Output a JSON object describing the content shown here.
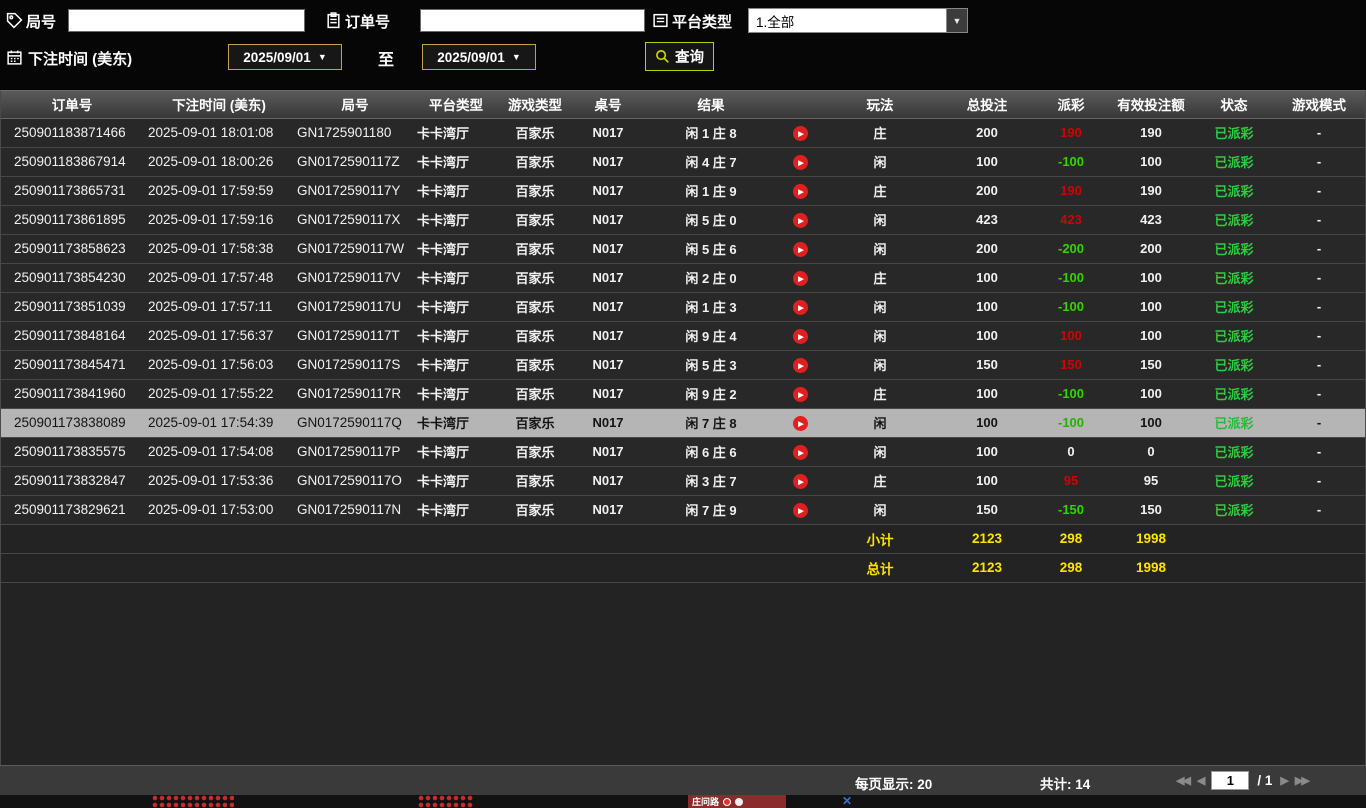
{
  "filters": {
    "round_label": "局号",
    "round_value": "",
    "order_label": "订单号",
    "order_value": "",
    "platform_label": "平台类型",
    "platform_value": "1.全部",
    "bet_time_label": "下注时间 (美东)",
    "date_from": "2025/09/01",
    "to_label": "至",
    "date_to": "2025/09/01",
    "search_label": "查询"
  },
  "table": {
    "headers": [
      "订单号",
      "下注时间 (美东)",
      "局号",
      "平台类型",
      "游戏类型",
      "桌号",
      "结果",
      "",
      "玩法",
      "总投注",
      "派彩",
      "有效投注额",
      "状态",
      "游戏模式"
    ],
    "rows": [
      {
        "order_no": "250901183871466",
        "time": "2025-09-01 18:01:08",
        "round": "GN1725901180",
        "platform": "卡卡湾厅",
        "game": "百家乐",
        "table_no": "N017",
        "result": "闲 1 庄 8",
        "play": "庄",
        "total_bet": "200",
        "payout": "190",
        "payout_class": "pos",
        "valid_bet": "190",
        "status": "已派彩",
        "mode": "-",
        "highlighted": false
      },
      {
        "order_no": "250901183867914",
        "time": "2025-09-01 18:00:26",
        "round": "GN0172590117Z",
        "platform": "卡卡湾厅",
        "game": "百家乐",
        "table_no": "N017",
        "result": "闲 4 庄 7",
        "play": "闲",
        "total_bet": "100",
        "payout": "-100",
        "payout_class": "neg",
        "valid_bet": "100",
        "status": "已派彩",
        "mode": "-",
        "highlighted": false
      },
      {
        "order_no": "250901173865731",
        "time": "2025-09-01 17:59:59",
        "round": "GN0172590117Y",
        "platform": "卡卡湾厅",
        "game": "百家乐",
        "table_no": "N017",
        "result": "闲 1 庄 9",
        "play": "庄",
        "total_bet": "200",
        "payout": "190",
        "payout_class": "pos",
        "valid_bet": "190",
        "status": "已派彩",
        "mode": "-",
        "highlighted": false
      },
      {
        "order_no": "250901173861895",
        "time": "2025-09-01 17:59:16",
        "round": "GN0172590117X",
        "platform": "卡卡湾厅",
        "game": "百家乐",
        "table_no": "N017",
        "result": "闲 5 庄 0",
        "play": "闲",
        "total_bet": "423",
        "payout": "423",
        "payout_class": "pos",
        "valid_bet": "423",
        "status": "已派彩",
        "mode": "-",
        "highlighted": false
      },
      {
        "order_no": "250901173858623",
        "time": "2025-09-01 17:58:38",
        "round": "GN0172590117W",
        "platform": "卡卡湾厅",
        "game": "百家乐",
        "table_no": "N017",
        "result": "闲 5 庄 6",
        "play": "闲",
        "total_bet": "200",
        "payout": "-200",
        "payout_class": "neg",
        "valid_bet": "200",
        "status": "已派彩",
        "mode": "-",
        "highlighted": false
      },
      {
        "order_no": "250901173854230",
        "time": "2025-09-01 17:57:48",
        "round": "GN0172590117V",
        "platform": "卡卡湾厅",
        "game": "百家乐",
        "table_no": "N017",
        "result": "闲 2 庄 0",
        "play": "庄",
        "total_bet": "100",
        "payout": "-100",
        "payout_class": "neg",
        "valid_bet": "100",
        "status": "已派彩",
        "mode": "-",
        "highlighted": false
      },
      {
        "order_no": "250901173851039",
        "time": "2025-09-01 17:57:11",
        "round": "GN0172590117U",
        "platform": "卡卡湾厅",
        "game": "百家乐",
        "table_no": "N017",
        "result": "闲 1 庄 3",
        "play": "闲",
        "total_bet": "100",
        "payout": "-100",
        "payout_class": "neg",
        "valid_bet": "100",
        "status": "已派彩",
        "mode": "-",
        "highlighted": false
      },
      {
        "order_no": "250901173848164",
        "time": "2025-09-01 17:56:37",
        "round": "GN0172590117T",
        "platform": "卡卡湾厅",
        "game": "百家乐",
        "table_no": "N017",
        "result": "闲 9 庄 4",
        "play": "闲",
        "total_bet": "100",
        "payout": "100",
        "payout_class": "pos",
        "valid_bet": "100",
        "status": "已派彩",
        "mode": "-",
        "highlighted": false
      },
      {
        "order_no": "250901173845471",
        "time": "2025-09-01 17:56:03",
        "round": "GN0172590117S",
        "platform": "卡卡湾厅",
        "game": "百家乐",
        "table_no": "N017",
        "result": "闲 5 庄 3",
        "play": "闲",
        "total_bet": "150",
        "payout": "150",
        "payout_class": "pos",
        "valid_bet": "150",
        "status": "已派彩",
        "mode": "-",
        "highlighted": false
      },
      {
        "order_no": "250901173841960",
        "time": "2025-09-01 17:55:22",
        "round": "GN0172590117R",
        "platform": "卡卡湾厅",
        "game": "百家乐",
        "table_no": "N017",
        "result": "闲 9 庄 2",
        "play": "庄",
        "total_bet": "100",
        "payout": "-100",
        "payout_class": "neg",
        "valid_bet": "100",
        "status": "已派彩",
        "mode": "-",
        "highlighted": false
      },
      {
        "order_no": "250901173838089",
        "time": "2025-09-01 17:54:39",
        "round": "GN0172590117Q",
        "platform": "卡卡湾厅",
        "game": "百家乐",
        "table_no": "N017",
        "result": "闲 7 庄 8",
        "play": "闲",
        "total_bet": "100",
        "payout": "-100",
        "payout_class": "neg",
        "valid_bet": "100",
        "status": "已派彩",
        "mode": "-",
        "highlighted": true
      },
      {
        "order_no": "250901173835575",
        "time": "2025-09-01 17:54:08",
        "round": "GN0172590117P",
        "platform": "卡卡湾厅",
        "game": "百家乐",
        "table_no": "N017",
        "result": "闲 6 庄 6",
        "play": "闲",
        "total_bet": "100",
        "payout": "0",
        "payout_class": "zero",
        "valid_bet": "0",
        "status": "已派彩",
        "mode": "-",
        "highlighted": false
      },
      {
        "order_no": "250901173832847",
        "time": "2025-09-01 17:53:36",
        "round": "GN0172590117O",
        "platform": "卡卡湾厅",
        "game": "百家乐",
        "table_no": "N017",
        "result": "闲 3 庄 7",
        "play": "庄",
        "total_bet": "100",
        "payout": "95",
        "payout_class": "pos",
        "valid_bet": "95",
        "status": "已派彩",
        "mode": "-",
        "highlighted": false
      },
      {
        "order_no": "250901173829621",
        "time": "2025-09-01 17:53:00",
        "round": "GN0172590117N",
        "platform": "卡卡湾厅",
        "game": "百家乐",
        "table_no": "N017",
        "result": "闲 7 庄 9",
        "play": "闲",
        "total_bet": "150",
        "payout": "-150",
        "payout_class": "neg",
        "valid_bet": "150",
        "status": "已派彩",
        "mode": "-",
        "highlighted": false
      }
    ],
    "subtotal": {
      "label": "小计",
      "total_bet": "2123",
      "payout": "298",
      "valid_bet": "1998"
    },
    "total": {
      "label": "总计",
      "total_bet": "2123",
      "payout": "298",
      "valid_bet": "1998"
    }
  },
  "footer": {
    "per_page": "每页显示: 20",
    "total_count": "共计: 14",
    "page": "1",
    "page_total": "/  1"
  },
  "background_game": {
    "road_legend": "庄问路"
  },
  "colors": {
    "payout_positive": "#cf0404",
    "payout_negative": "#35d400",
    "status_paid": "#2ecc40",
    "summary_text": "#ffe400",
    "query_border": "#b8cf08",
    "highlight_row": "#b5b5b5"
  }
}
